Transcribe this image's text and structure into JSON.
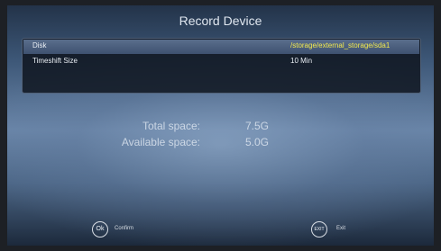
{
  "header": {
    "title": "Record Device"
  },
  "settings": {
    "rows": [
      {
        "label": "Disk",
        "value": "/storage/external_storage/sda1",
        "selected": true
      },
      {
        "label": "Timeshift Size",
        "value": "10 Min",
        "selected": false
      }
    ]
  },
  "storage": {
    "total_label": "Total space:",
    "total_value": "7.5G",
    "available_label": "Available space:",
    "available_value": "5.0G"
  },
  "footer": {
    "confirm_icon": "Ok",
    "confirm_label": "Confirm",
    "exit_icon": "EXIT",
    "exit_label": "Exit"
  },
  "colors": {
    "highlight_text": "#f2e94e",
    "selected_row": "#4a5d7c"
  }
}
